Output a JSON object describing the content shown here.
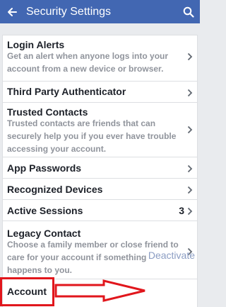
{
  "header": {
    "title": "Security Settings",
    "back_icon": "arrow-left-icon",
    "search_icon": "search-icon",
    "background": "#4267b2"
  },
  "settings": {
    "login_alerts": {
      "title": "Login Alerts",
      "description": "Get an alert when anyone logs into your account from a new device or browser."
    },
    "third_party_authenticator": {
      "title": "Third Party Authenticator"
    },
    "trusted_contacts": {
      "title": "Trusted Contacts",
      "description": "Trusted contacts are friends that can securely help you if you ever have trouble accessing your account."
    },
    "app_passwords": {
      "title": "App Passwords"
    },
    "recognized_devices": {
      "title": "Recognized Devices"
    },
    "active_sessions": {
      "title": "Active Sessions",
      "count": "3"
    },
    "legacy_contact": {
      "title": "Legacy Contact",
      "description": "Choose a family member or close friend to care for your account if something happens to you."
    },
    "account": {
      "title": "Account",
      "action": "Deactivate"
    }
  },
  "annotation": {
    "color": "#e1161c"
  }
}
